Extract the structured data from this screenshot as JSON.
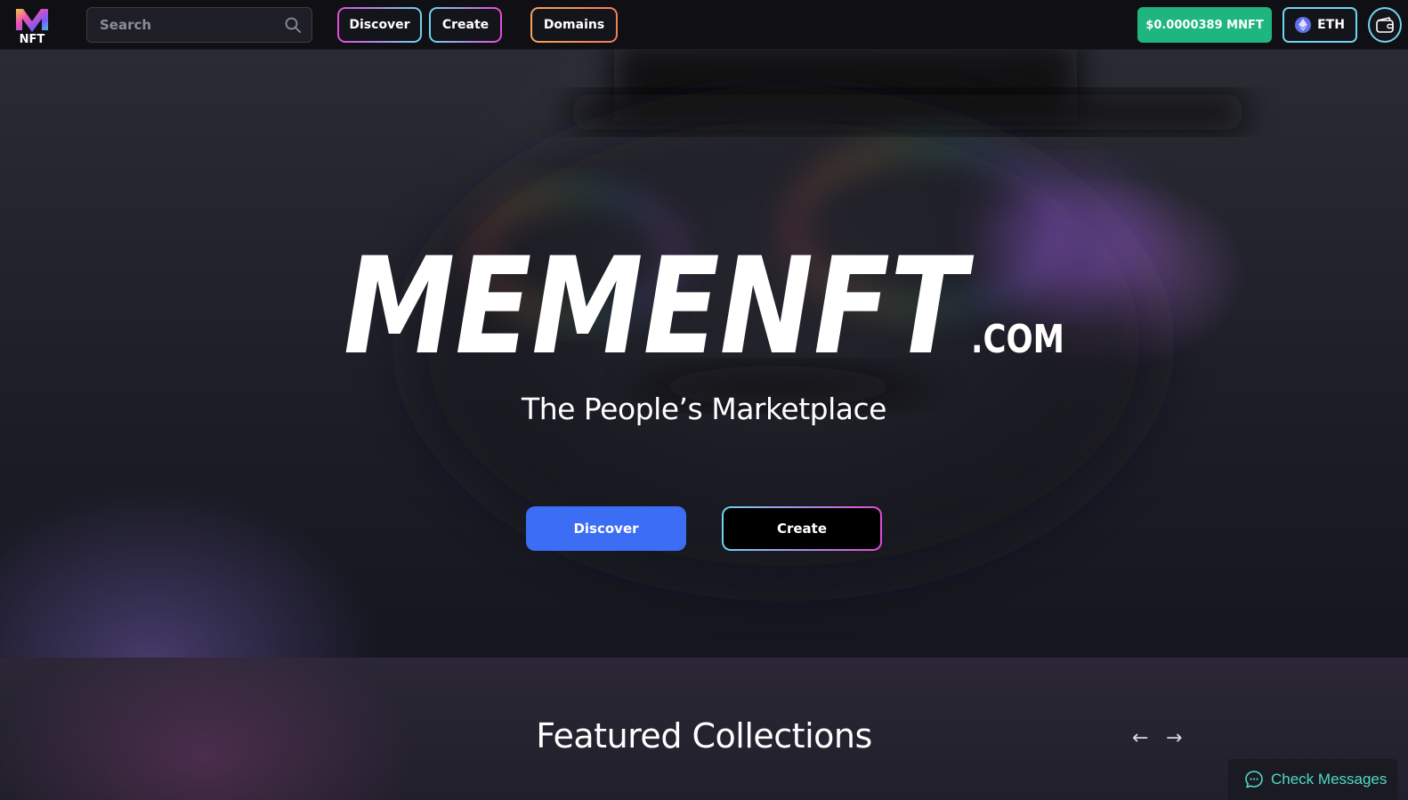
{
  "header": {
    "logo_text": "NFT",
    "search": {
      "placeholder": "Search",
      "value": ""
    },
    "nav": {
      "discover": "Discover",
      "create": "Create",
      "domains": "Domains"
    },
    "token_price": "$0.0000389 MNFT",
    "network": "ETH"
  },
  "hero": {
    "wordmark": {
      "main": "MEMENFT",
      "suffix": ".COM"
    },
    "tagline": "The People’s Marketplace",
    "discover_button": "Discover",
    "create_button": "Create"
  },
  "featured": {
    "title": "Featured Collections",
    "prev_arrow": "←",
    "next_arrow": "→"
  },
  "chat": {
    "label": "Check Messages"
  },
  "colors": {
    "accent_blue": "#3c6ef5",
    "price_green": "#1fb57f",
    "chat_teal": "#4fd9c6",
    "gradient_cyan": "#6fd3f5",
    "gradient_pink": "#e24bd8",
    "gradient_orange": "#f2a35c"
  },
  "icons": {
    "search": "search-icon",
    "eth": "ethereum-icon",
    "wallet": "wallet-icon",
    "chat": "chat-bubble-icon"
  }
}
